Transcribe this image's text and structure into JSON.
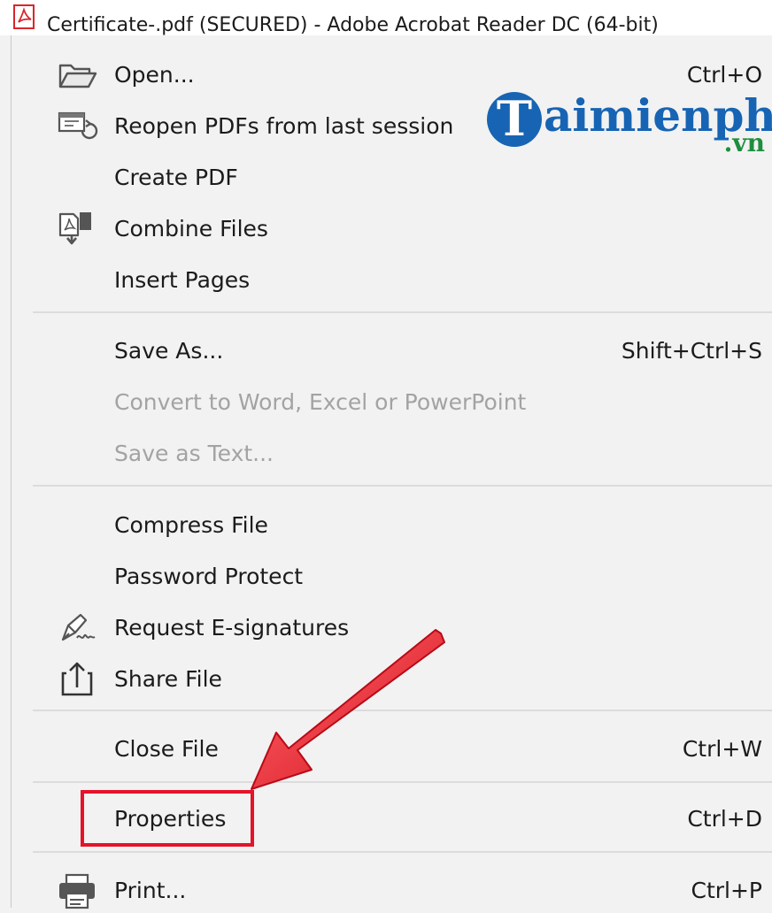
{
  "window": {
    "title": "Certificate-.pdf (SECURED) - Adobe Acrobat Reader DC (64-bit)",
    "icon": "acrobat-pdf-icon"
  },
  "watermark": {
    "brand_t": "T",
    "brand_text": "aimienphi",
    "brand_suffix": ".vn",
    "colors": {
      "blue": "#1764b4",
      "green": "#1e8e3e"
    }
  },
  "menu": {
    "items": [
      {
        "label": "Open...",
        "shortcut": "Ctrl+O",
        "icon": "folder-open-icon"
      },
      {
        "label": "Reopen PDFs from last session",
        "shortcut": "",
        "icon": "reopen-session-icon"
      },
      {
        "label": "Create PDF",
        "shortcut": ""
      },
      {
        "label": "Combine Files",
        "shortcut": "",
        "icon": "combine-files-icon"
      },
      {
        "label": "Insert Pages",
        "shortcut": ""
      },
      {
        "label": "Save As...",
        "shortcut": "Shift+Ctrl+S"
      },
      {
        "label": "Convert to Word, Excel or PowerPoint",
        "shortcut": "",
        "disabled": true
      },
      {
        "label": "Save as Text...",
        "shortcut": "",
        "disabled": true
      },
      {
        "label": "Compress File",
        "shortcut": ""
      },
      {
        "label": "Password Protect",
        "shortcut": ""
      },
      {
        "label": "Request E-signatures",
        "shortcut": "",
        "icon": "e-signature-pen-icon"
      },
      {
        "label": "Share File",
        "shortcut": "",
        "icon": "share-upload-icon"
      },
      {
        "label": "Close File",
        "shortcut": "Ctrl+W"
      },
      {
        "label": "Properties",
        "shortcut": "Ctrl+D",
        "highlighted": true
      },
      {
        "label": "Print...",
        "shortcut": "Ctrl+P",
        "icon": "printer-icon"
      }
    ]
  },
  "annotation": {
    "highlight_color": "#e5132a",
    "arrow_color": "#e5132a"
  }
}
